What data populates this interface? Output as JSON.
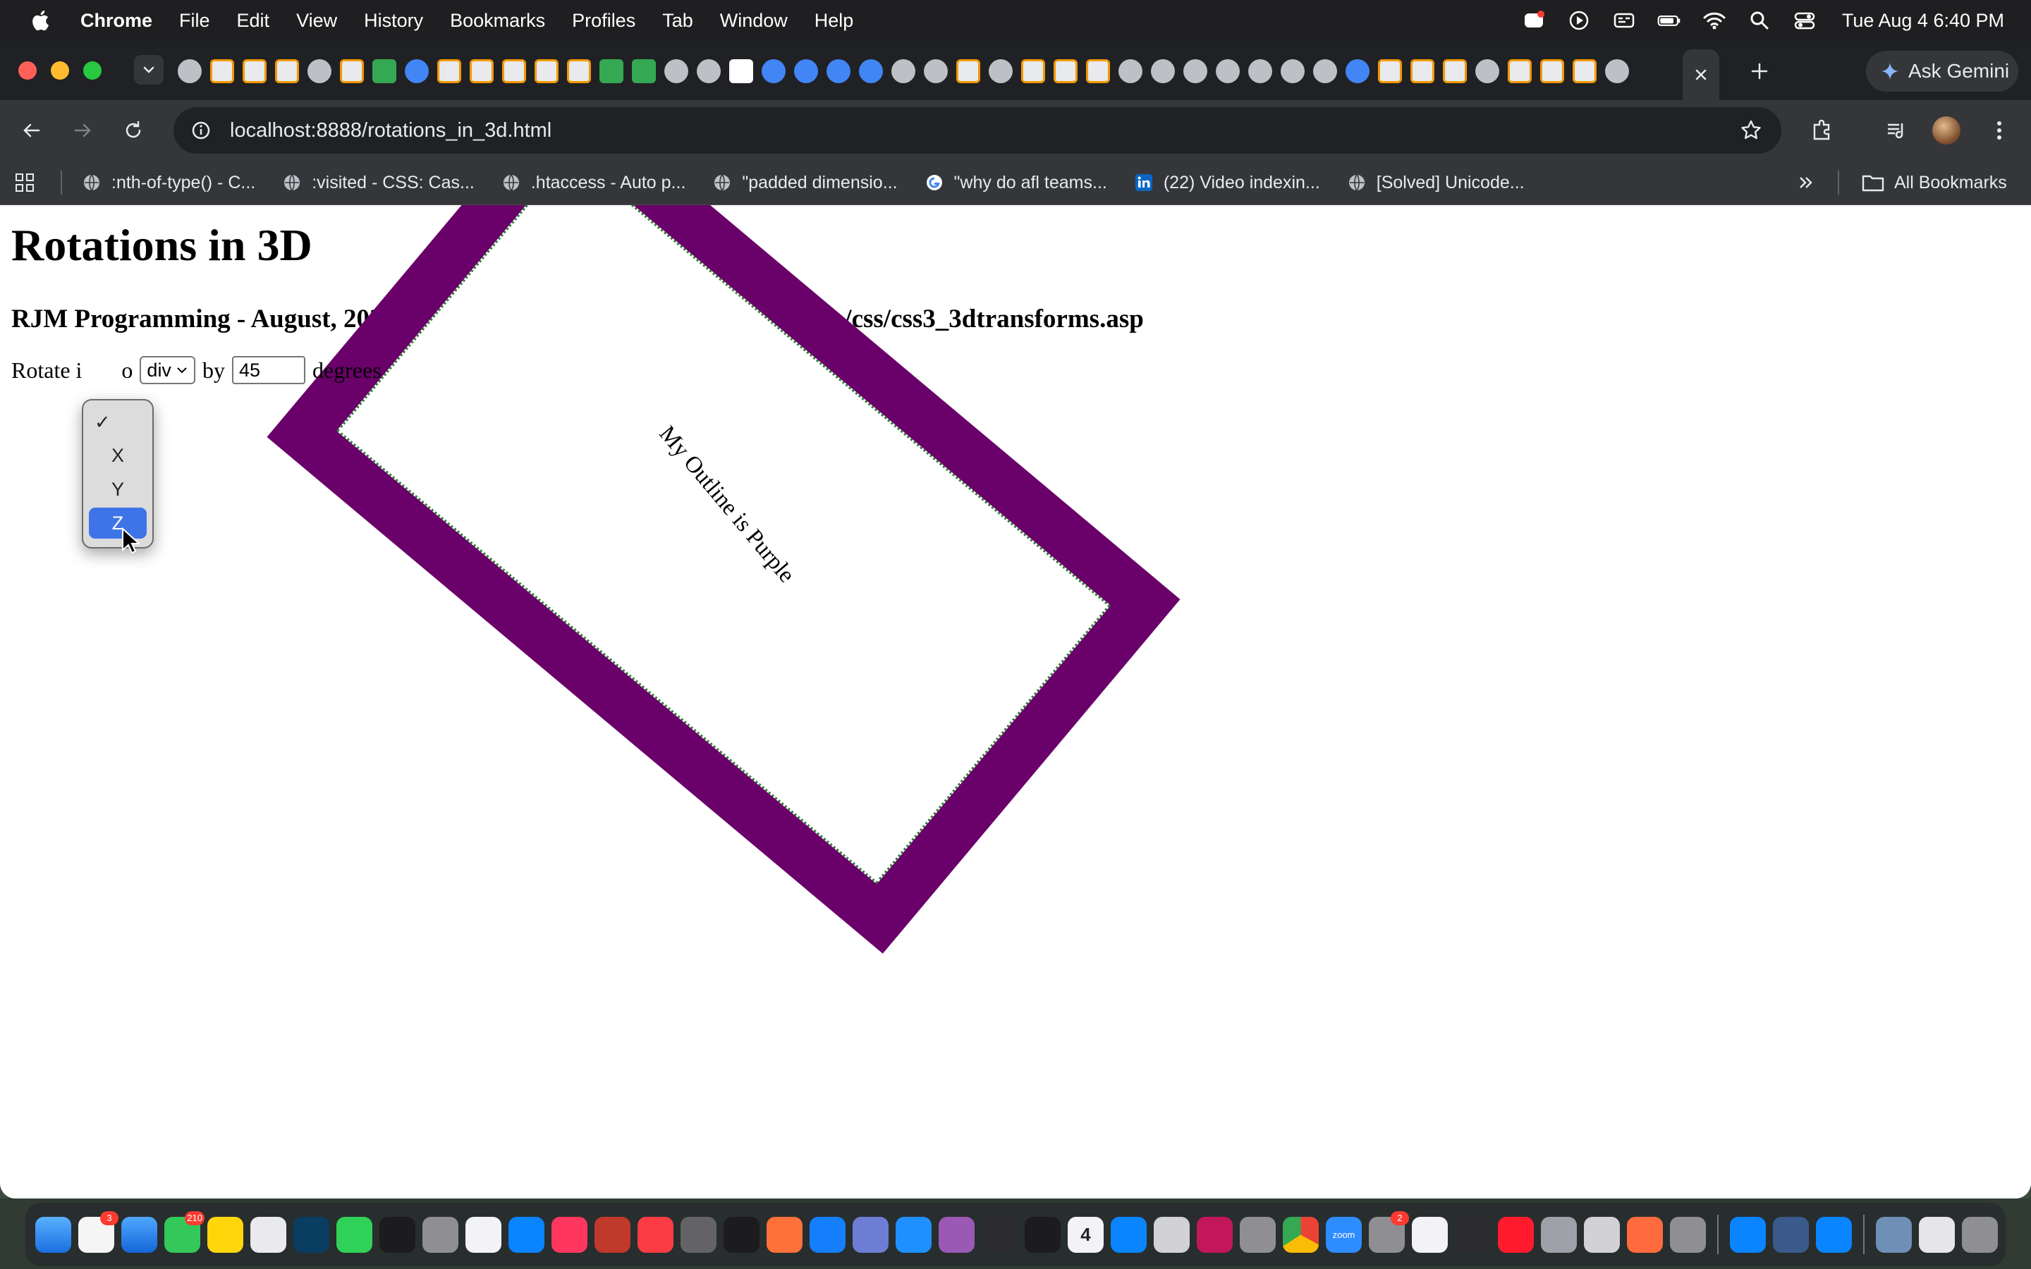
{
  "menubar": {
    "app_name": "Chrome",
    "items": [
      "File",
      "Edit",
      "View",
      "History",
      "Bookmarks",
      "Profiles",
      "Tab",
      "Window",
      "Help"
    ],
    "clock": "Tue Aug 4  6:40 PM"
  },
  "tabstrip": {
    "gemini_label": "Ask Gemini"
  },
  "toolbar": {
    "url": "localhost:8888/rotations_in_3d.html"
  },
  "bookmarks": {
    "items": [
      ":nth-of-type() - C...",
      ":visited - CSS: Cas...",
      ".htaccess - Auto p...",
      "\"padded dimensio...",
      "\"why do afl teams...",
      "(22) Video indexin...",
      "[Solved] Unicode..."
    ],
    "all_label": "All Bookmarks"
  },
  "page": {
    "title": "Rotations in 3D",
    "subtitle": "RJM Programming - August, 2026 ... thanks to https://www.w3schools.com/css/css3_3dtransforms.asp",
    "rotate_prefix": "Rotate i",
    "to_word": "o",
    "element_select": "div",
    "by_word": "by",
    "degrees_value": "45",
    "degrees_word": "degrees",
    "box_caption": "My Outline is Purple",
    "outline_color": "#6a006a",
    "axis_options": [
      "X",
      "Y",
      "Z"
    ],
    "axis_selected": "Z"
  },
  "dock": {
    "calendar_day": "4",
    "zoom_label": "zoom",
    "badges": {
      "reminders": "3",
      "messages": "210",
      "settings": "2"
    }
  }
}
